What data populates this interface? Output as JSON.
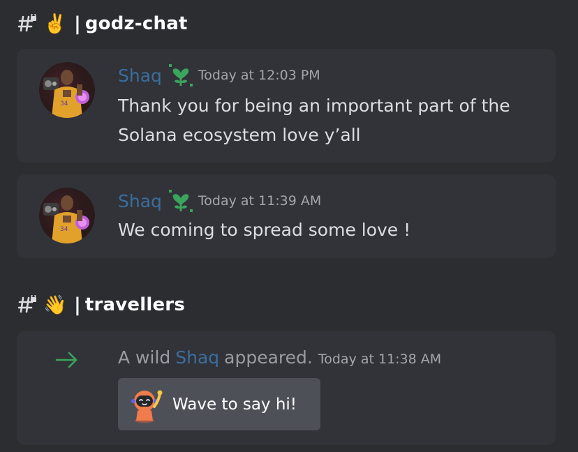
{
  "channels": [
    {
      "emoji": "✌️",
      "separator": "|",
      "name": "godz-chat",
      "messages": [
        {
          "author": "Shaq",
          "timestamp": "Today at 12:03 PM",
          "text": "Thank you for being an important part of the Solana ecosystem love y’all"
        },
        {
          "author": "Shaq",
          "timestamp": "Today at 11:39 AM",
          "text": "We coming to spread some love !"
        }
      ]
    },
    {
      "emoji": "👋",
      "separator": "|",
      "name": "travellers",
      "system_message": {
        "prefix": "A wild",
        "mention": "Shaq",
        "suffix": "appeared.",
        "timestamp": "Today at 11:38 AM",
        "button_label": "Wave to say hi!"
      }
    }
  ],
  "colors": {
    "background": "#2b2d31",
    "card": "#313338",
    "author_link": "#3b6e9e",
    "join_arrow": "#3ba55d",
    "wave_button": "#4e5058"
  },
  "icons": {
    "channel": "locked-hash-icon",
    "badge": "heart-sprout-icon",
    "join": "arrow-right-icon",
    "sticker": "wumpus-wave-icon"
  }
}
